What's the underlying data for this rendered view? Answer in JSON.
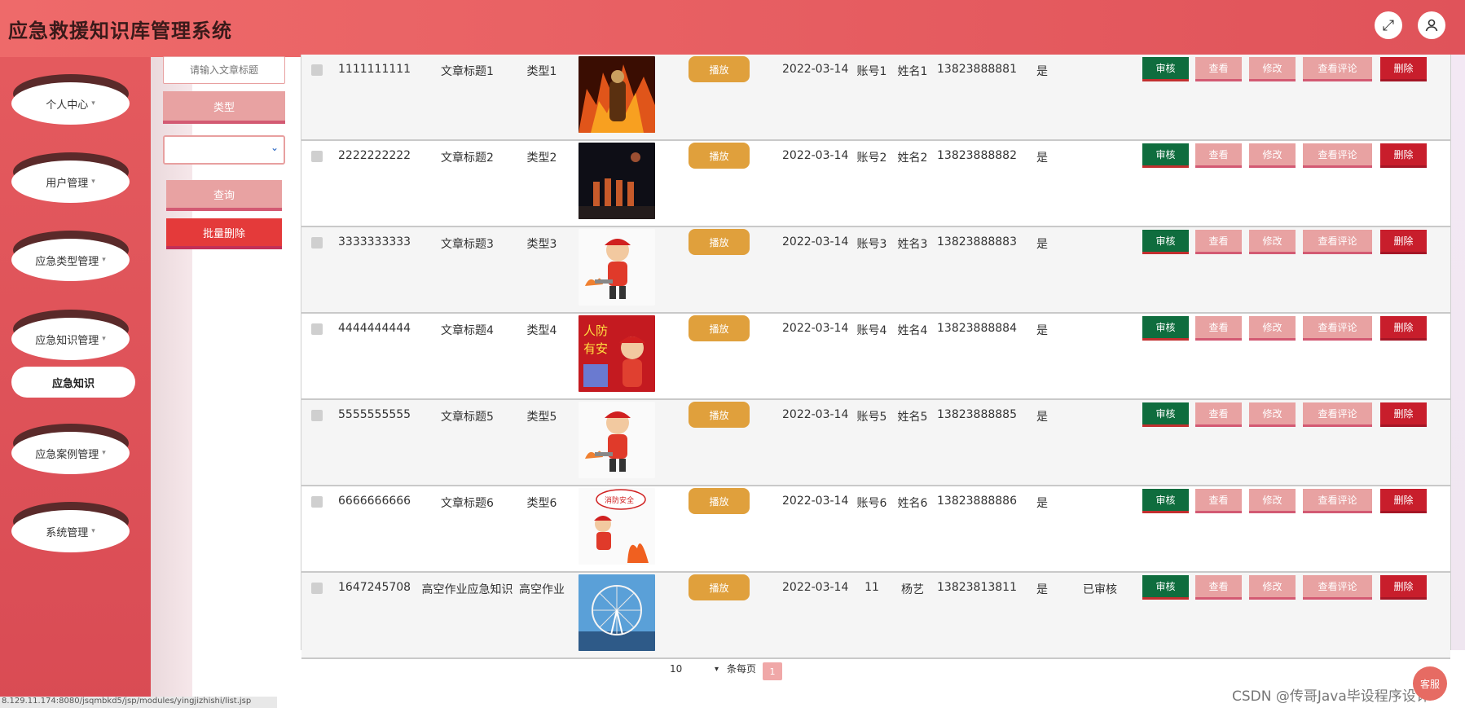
{
  "header": {
    "title": "应急救援知识库管理系统"
  },
  "sidebar": {
    "items": [
      {
        "label": "个人中心"
      },
      {
        "label": "用户管理"
      },
      {
        "label": "应急类型管理"
      },
      {
        "label": "应急知识管理"
      },
      {
        "label": "应急案例管理"
      },
      {
        "label": "系统管理"
      }
    ],
    "submenu_active": "应急知识",
    "caret": "▾"
  },
  "filters": {
    "search_placeholder": "请输入文章标题",
    "type_label": "类型",
    "type_selected": "",
    "query_label": "查询",
    "batch_delete_label": "批量删除"
  },
  "table": {
    "actions": {
      "play": "播放",
      "audit": "审核",
      "view": "查看",
      "edit": "修改",
      "comments": "查看评论",
      "delete": "删除"
    },
    "rows": [
      {
        "id": "1111111111",
        "title": "文章标题1",
        "type": "类型1",
        "date": "2022-03-14",
        "account": "账号1",
        "name": "姓名1",
        "phone": "13823888881",
        "flag": "是",
        "status": "",
        "thumb": "fire"
      },
      {
        "id": "2222222222",
        "title": "文章标题2",
        "type": "类型2",
        "date": "2022-03-14",
        "account": "账号2",
        "name": "姓名2",
        "phone": "13823888882",
        "flag": "是",
        "status": "",
        "thumb": "night"
      },
      {
        "id": "3333333333",
        "title": "文章标题3",
        "type": "类型3",
        "date": "2022-03-14",
        "account": "账号3",
        "name": "姓名3",
        "phone": "13823888883",
        "flag": "是",
        "status": "",
        "thumb": "cartoon"
      },
      {
        "id": "4444444444",
        "title": "文章标题4",
        "type": "类型4",
        "date": "2022-03-14",
        "account": "账号4",
        "name": "姓名4",
        "phone": "13823888884",
        "flag": "是",
        "status": "",
        "thumb": "poster"
      },
      {
        "id": "5555555555",
        "title": "文章标题5",
        "type": "类型5",
        "date": "2022-03-14",
        "account": "账号5",
        "name": "姓名5",
        "phone": "13823888885",
        "flag": "是",
        "status": "",
        "thumb": "cartoon"
      },
      {
        "id": "6666666666",
        "title": "文章标题6",
        "type": "类型6",
        "date": "2022-03-14",
        "account": "账号6",
        "name": "姓名6",
        "phone": "13823888886",
        "flag": "是",
        "status": "",
        "thumb": "cartoon2"
      },
      {
        "id": "1647245708",
        "title": "高空作业应急知识",
        "type": "高空作业",
        "date": "2022-03-14",
        "account": "11",
        "name": "杨艺",
        "phone": "13823813811",
        "flag": "是",
        "status": "已审核",
        "thumb": "wheel"
      }
    ]
  },
  "pagination": {
    "page_size": "10",
    "per_page_label": "条每页",
    "current_page": "1"
  },
  "statusbar": {
    "url": "8.129.11.174:8080/jsqmbkd5/jsp/modules/yingjizhishi/list.jsp"
  },
  "watermark": "CSDN @传哥Java毕设程序设计",
  "float_button": "客服"
}
